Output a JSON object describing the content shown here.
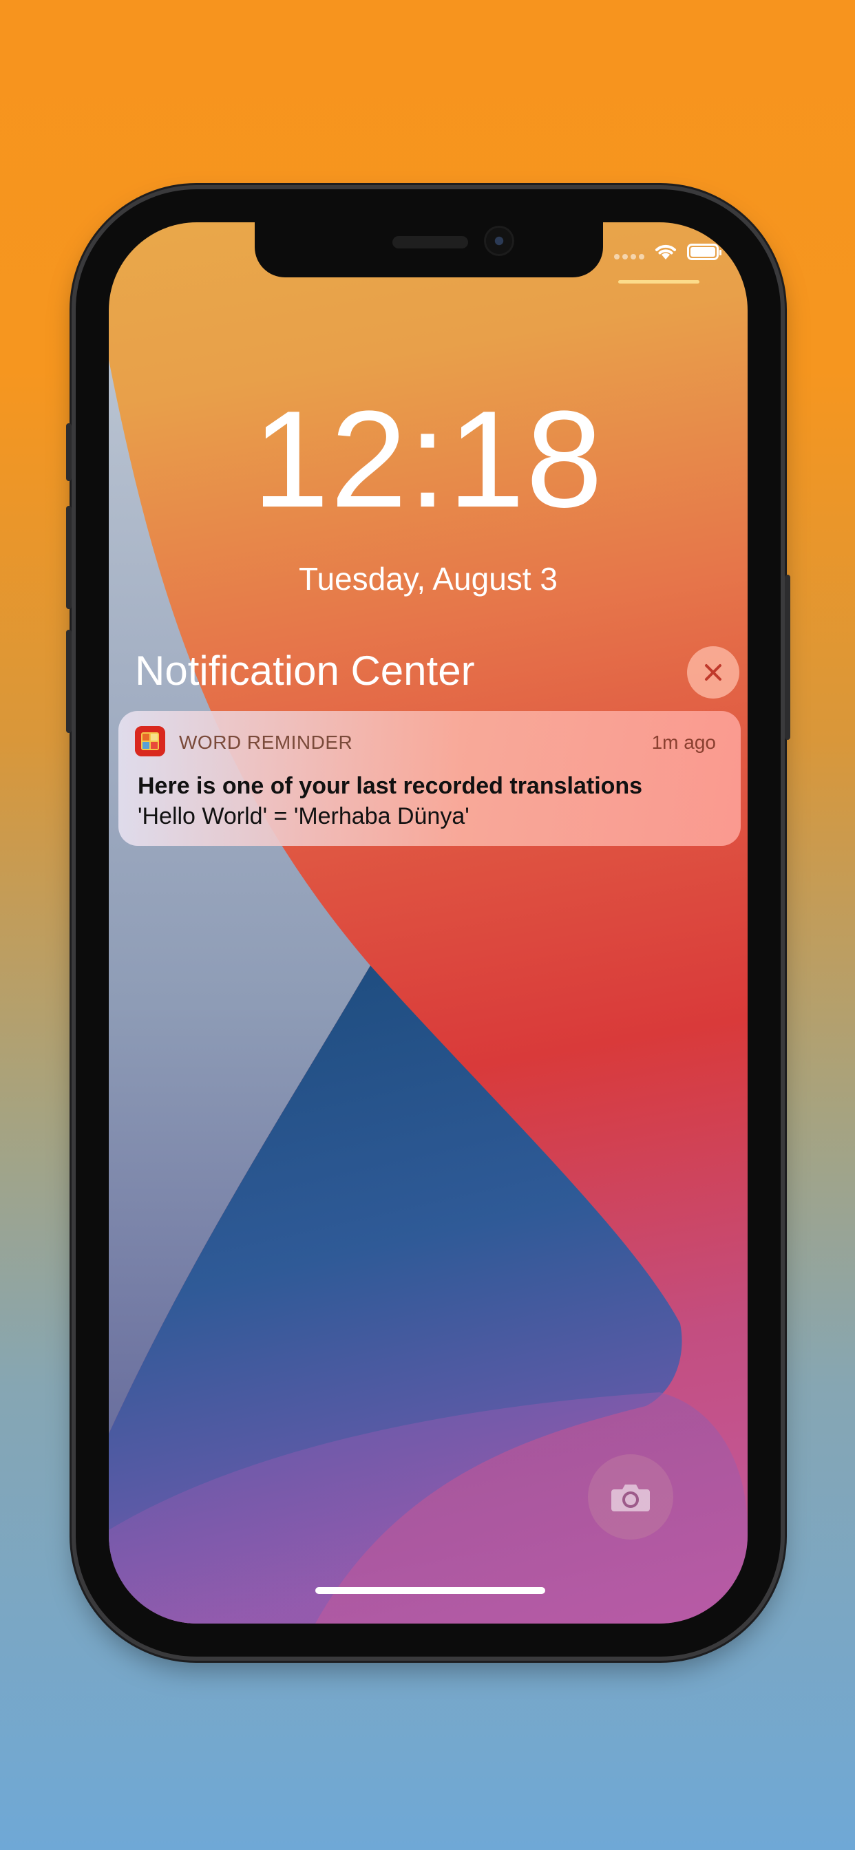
{
  "lock_screen": {
    "time": "12:18",
    "date": "Tuesday, August 3"
  },
  "notification_center": {
    "title": "Notification Center",
    "close_icon": "close-icon"
  },
  "notification": {
    "app_name": "WORD REMINDER",
    "time_ago": "1m ago",
    "title": "Here is one of your last recorded translations",
    "body": "'Hello World' = 'Merhaba Dünya'",
    "app_icon": "word-reminder-app-icon"
  },
  "status_bar": {
    "icons": [
      "signal-dots-icon",
      "wifi-icon",
      "battery-icon"
    ]
  },
  "quick_actions": {
    "camera_icon": "camera-icon"
  },
  "colors": {
    "background_top": "#f7941e",
    "background_bottom": "#6fa8d6",
    "notification_accent": "#d9281e"
  }
}
